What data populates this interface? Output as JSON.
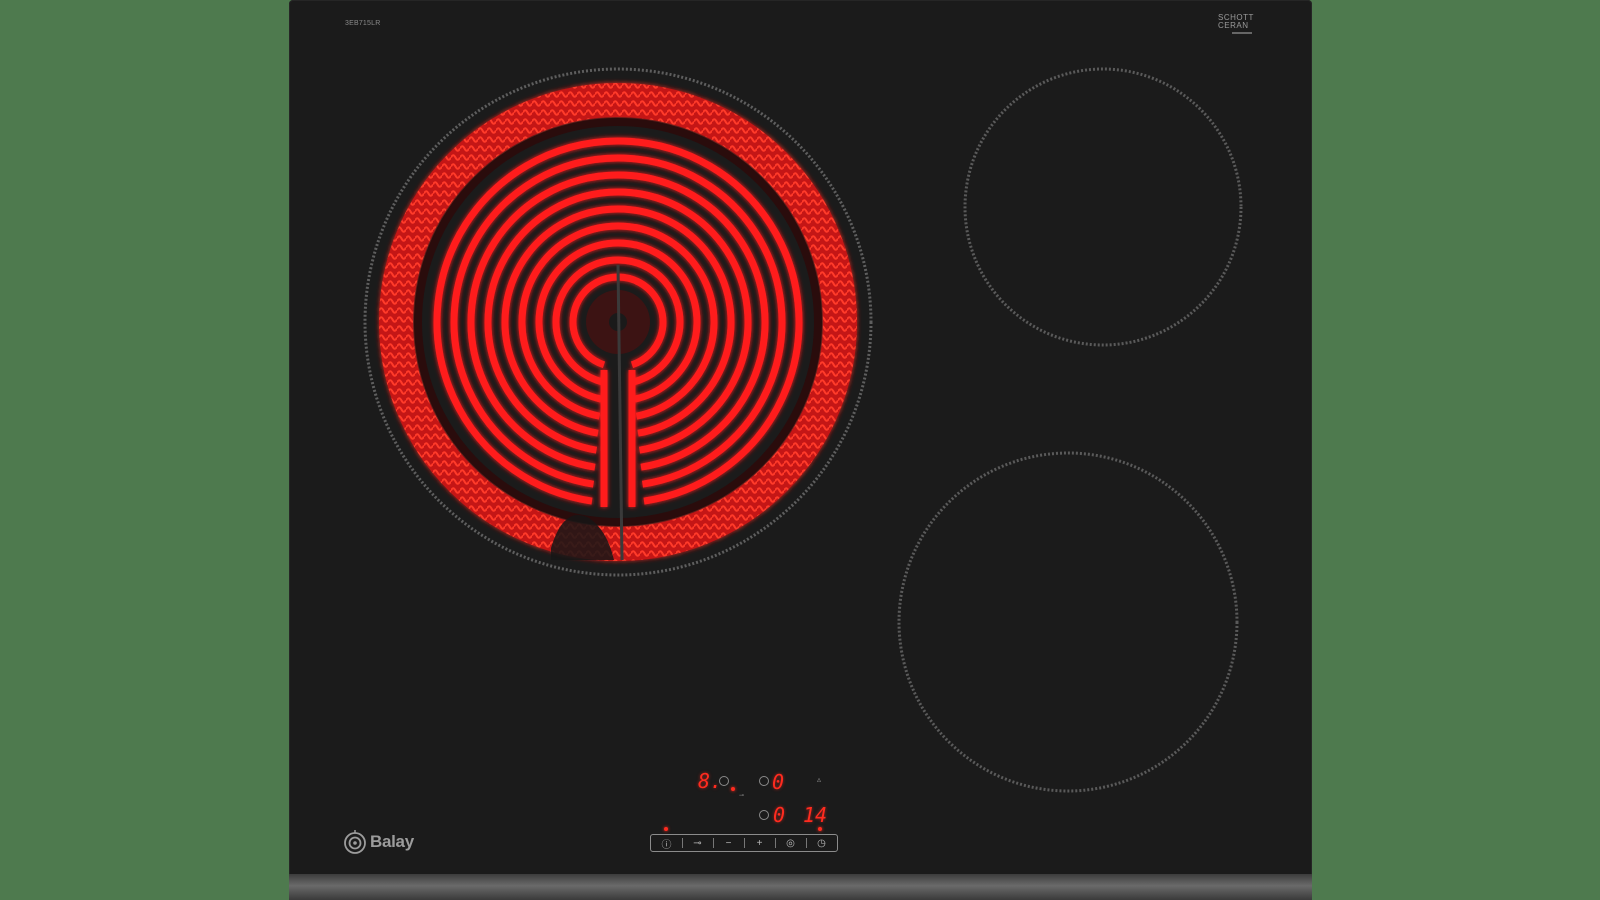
{
  "product": {
    "model_code": "3EB715LR",
    "glass_brand_line1": "SCHOTT",
    "glass_brand_line2": "CERAN",
    "brand_name": "Balay"
  },
  "cooking_zones": [
    {
      "id": "front-left-large",
      "state": "on",
      "color": "#ff1e1e"
    },
    {
      "id": "rear-right-small",
      "state": "off",
      "color": "#5a5a5a"
    },
    {
      "id": "front-right-medium",
      "state": "off",
      "color": "#5a5a5a"
    }
  ],
  "display": {
    "zone_level": "8.",
    "power_level": "0",
    "timer_zone_value": "0",
    "timer_value": "14",
    "accent_color": "#ff2b1f"
  },
  "controls": {
    "buttons": [
      {
        "icon": "power-icon",
        "symbol": "ⓘ"
      },
      {
        "icon": "lock-key-icon",
        "symbol": "⊸"
      },
      {
        "icon": "minus-icon",
        "symbol": "−"
      },
      {
        "icon": "plus-icon",
        "symbol": "+"
      },
      {
        "icon": "zone-select-icon",
        "symbol": "◎"
      },
      {
        "icon": "timer-icon",
        "symbol": "◷"
      }
    ]
  },
  "colors": {
    "background": "#4e7a4e",
    "glass": "#1b1b1b",
    "heating_element": "#ff1e1e",
    "zone_outline": "#5a5a5a"
  }
}
